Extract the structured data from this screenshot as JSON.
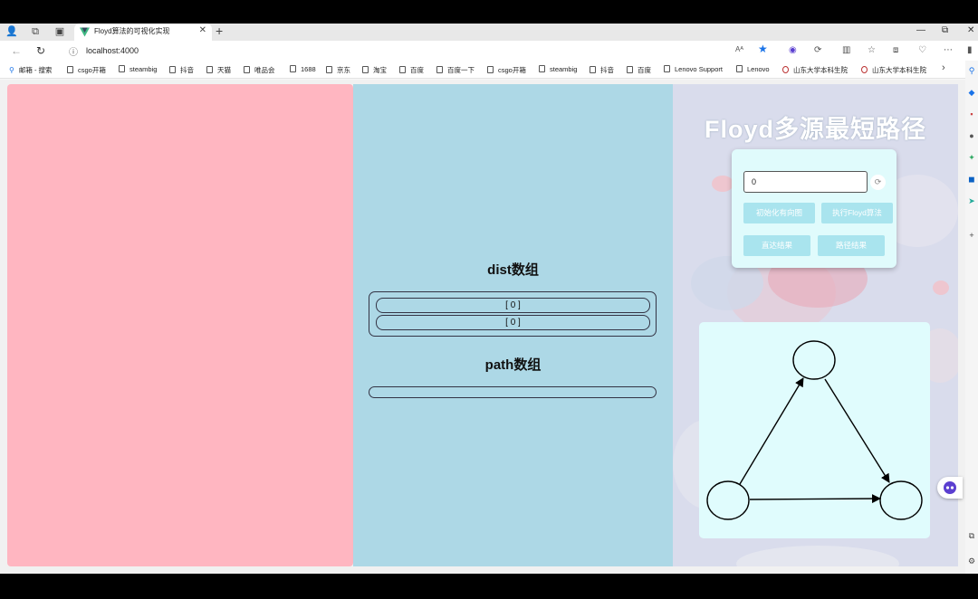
{
  "browser": {
    "tab_title": "Floyd算法的可视化实现",
    "tab_close": "✕",
    "new_tab": "+",
    "url": "localhost:4000",
    "window_controls": {
      "minimize": "—",
      "restore": "⧉",
      "close": "✕"
    },
    "font_size_label": "Aᴬ",
    "bookmarks": [
      {
        "label": "邮箱 - 搜索",
        "icon": "search-icon"
      },
      {
        "label": "csgo开箱",
        "icon": "page-icon"
      },
      {
        "label": "steambig",
        "icon": "page-icon"
      },
      {
        "label": "抖音",
        "icon": "page-icon"
      },
      {
        "label": "天猫",
        "icon": "page-icon"
      },
      {
        "label": "唯品会",
        "icon": "page-icon"
      },
      {
        "label": "1688",
        "icon": "page-icon"
      },
      {
        "label": "京东",
        "icon": "page-icon"
      },
      {
        "label": "淘宝",
        "icon": "page-icon"
      },
      {
        "label": "百度",
        "icon": "page-icon"
      },
      {
        "label": "百度一下",
        "icon": "page-icon"
      },
      {
        "label": "csgo开箱",
        "icon": "page-icon"
      },
      {
        "label": "steambig",
        "icon": "page-icon"
      },
      {
        "label": "抖音",
        "icon": "page-icon"
      },
      {
        "label": "百度",
        "icon": "page-icon"
      },
      {
        "label": "Lenovo Support",
        "icon": "page-icon"
      },
      {
        "label": "Lenovo",
        "icon": "page-icon"
      },
      {
        "label": "山东大学本科生院",
        "icon": "sdu-icon"
      },
      {
        "label": "山东大学本科生院",
        "icon": "sdu-icon"
      }
    ]
  },
  "app": {
    "title": "Floyd多源最短路径",
    "dist_title": "dist数组",
    "dist_rows": [
      "[ 0 ]",
      "[ 0 ]"
    ],
    "path_title": "path数组",
    "input_value": "0",
    "buttons": {
      "init": "初始化有向图",
      "run": "执行Floyd算法",
      "direct": "直达结果",
      "path": "路径结果"
    },
    "graph": {
      "nodes": [
        {
          "id": "top"
        },
        {
          "id": "bottom-left"
        },
        {
          "id": "bottom-right"
        }
      ],
      "edges": [
        {
          "from": "bottom-left",
          "to": "top"
        },
        {
          "from": "top",
          "to": "bottom-right"
        },
        {
          "from": "bottom-left",
          "to": "bottom-right"
        }
      ]
    }
  },
  "colors": {
    "left_panel": "#ffb6c1",
    "middle_panel": "#add8e6",
    "control_card": "#e0fbfc",
    "button": "#a9e4ee"
  }
}
